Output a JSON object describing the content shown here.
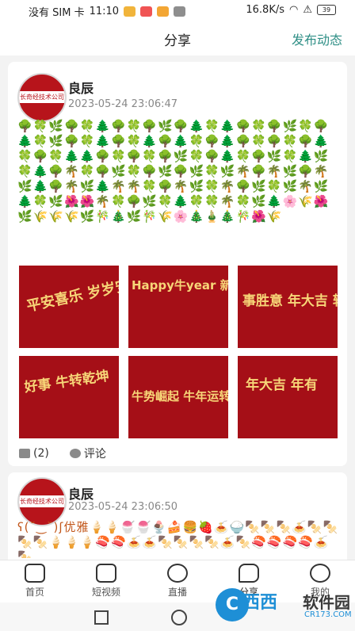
{
  "status_bar": {
    "carrier": "没有 SIM 卡",
    "time": "11:10",
    "speed": "16.8K/s",
    "battery": "39"
  },
  "header": {
    "title": "分享",
    "publish": "发布动态"
  },
  "posts": [
    {
      "avatar_text": "长奇经技术公司",
      "username": "良辰",
      "timestamp": "2023-05-24 23:06:47",
      "emoji_text": "🌳🍀🌿🌳🍀🌲🌳🍀🌳🌿🌳🌲🍀🌲🌳🍀🌳🌿🍀🌳🌲🍀🌿🌳🍀🌲🌳🍀🌲🌳🌲🍀🌳🌲🌳🍀🌳🍀🌳🌲🍀🌳🍀🌲🌲🌳🍀🌳🍀🌳🌿🍀🌳🌲🍀🌳🌿🍀🌲🌿🍀🌲🌳🌴🍀🌳🌿🍀🌳🌿🌳🌿🍀🌿🌴🌳🌴🌿🌳🌴🌿🌲🌳🌴🌿🌲🌴🌴🍀🌳🌴🌿🍀🌴🌳🌿🍀🌿🌴🌿🌲🍀🌿🌺🌺🌴🍀🌳🌿🍀🌲🍀🍀🌴🍀🌿🌲🌸🌾🌺🌿🌾🌾🌾🌿🎋🎄🌿🎋🌾🌸🎄🎍🎄🎋🌺🌾",
      "images": [
        "平安喜乐 岁岁安康",
        "Happy牛year 新春快乐 恭喜发财",
        "事胜意 年大吉 转乾坤",
        "好事 牛转乾坤",
        "牛势崛起 牛年运转 大吉大利",
        "年大吉 年有"
      ],
      "likes": "(2)",
      "comment": "评论"
    },
    {
      "avatar_text": "长奇经技术公司",
      "username": "良辰",
      "timestamp": "2023-05-24 23:06:50",
      "emoji_text": "ʕ(˘‿˘)ʃ优雅🍦🍦🍧🍧🍨🍰🍔🍓🍝🍚🍢🍢🍢🍝🍢🍢🍢🍢🍦🍦🍦🍣🍣🍝🍝🍢🍢🍢🍢🍝🍢🍣🍣🍣🍣🍝🍢"
    }
  ],
  "tabs": [
    {
      "label": "首页"
    },
    {
      "label": "短视频"
    },
    {
      "label": "直播"
    },
    {
      "label": "分享"
    },
    {
      "label": "我的"
    }
  ],
  "watermark": {
    "logo": "C",
    "text1": "西西",
    "text2": "软件园",
    "url": "CR173.COM"
  }
}
